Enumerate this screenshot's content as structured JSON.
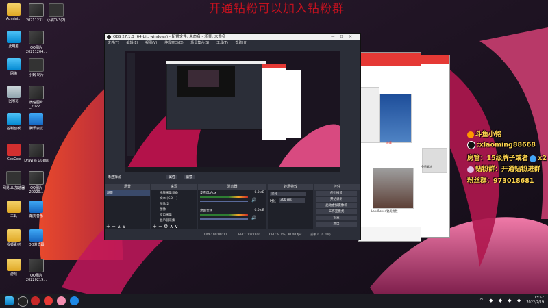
{
  "banner": "开通钻粉可以加入钻粉群",
  "desktop_icons": [
    {
      "label": "Admini...",
      "kind": "folder"
    },
    {
      "label": "20211231...",
      "kind": "thumb"
    },
    {
      "label": "小蜗TV3(2)",
      "kind": "darkapp"
    },
    {
      "label": "此电脑",
      "kind": "pc"
    },
    {
      "label": "QQ图片 20211204...",
      "kind": "thumb"
    },
    {
      "label": "网络",
      "kind": "pc"
    },
    {
      "label": "小蜗-制片",
      "kind": "darkapp"
    },
    {
      "label": "回收站",
      "kind": "bin"
    },
    {
      "label": "微信图片 _2022...",
      "kind": "thumb"
    },
    {
      "label": "控制面板",
      "kind": "pc"
    },
    {
      "label": "腾讯会议",
      "kind": "blueapp"
    },
    {
      "label": "GeeGee",
      "kind": "redapp"
    },
    {
      "label": "Draw & Guess",
      "kind": "thumb"
    },
    {
      "label": "网易UU加速器",
      "kind": "darkapp"
    },
    {
      "label": "QQ图片 20220...",
      "kind": "thumb"
    },
    {
      "label": "工具",
      "kind": "folder"
    },
    {
      "label": "酷狗音乐",
      "kind": "blueapp"
    },
    {
      "label": "视频素材",
      "kind": "folder"
    },
    {
      "label": "QQ浏览器",
      "kind": "blueapp"
    },
    {
      "label": "游戏",
      "kind": "folder"
    },
    {
      "label": "QQ图片 20220219...",
      "kind": "thumb"
    }
  ],
  "obs": {
    "title": "OBS 27.1.3 (64-bit, windows) - 配置文件: 未命名 - 场景: 未命名",
    "menu": [
      "文件(F)",
      "编辑(E)",
      "视图(V)",
      "停靠窗口(D)",
      "场景集合(S)",
      "工具(T)",
      "帮助(H)"
    ],
    "no_source": "未选择源",
    "props": "属性",
    "filters": "滤镜",
    "docks": {
      "scenes": "场景",
      "sources": "来源",
      "mixer": "混音器",
      "transitions": "转场特效",
      "controls": "控件"
    },
    "scene_item": "场景",
    "sources": [
      "视频采集设备",
      "文本 (GDI+)",
      "图像 2",
      "图像",
      "窗口采集",
      "显示器采集"
    ],
    "mixer": {
      "ch1": "麦克风/Aux",
      "ch2": "桌面音频",
      "ch1_db": "0.0 dB",
      "ch2_db": "0.0 dB"
    },
    "transition": {
      "type": "淡化",
      "duration_label": "时长",
      "duration": "300 ms"
    },
    "controls": [
      "停止推流",
      "开始录制",
      "启动虚拟摄像机",
      "工作室模式",
      "设置",
      "退出"
    ],
    "status": {
      "live": "LIVE: 00:00:00",
      "rec": "REC: 00:00:00",
      "cpu": "CPU: 9.1%, 30.00 fps",
      "dropped": "丢帧 0 (0.0%)"
    }
  },
  "browser": {
    "thumb_label1": "LandRover/路虎揽胜",
    "card_label": "收藏",
    "side_text1": "免费解冻",
    "side_text2": "ONSHY"
  },
  "overlay": {
    "douyu": "斗鱼小铭",
    "tiktok": ":xlaoming88668",
    "room": "房管：15级牌子或者",
    "x2": "x2",
    "fans": "钻粉群：开通钻粉进群",
    "fans_group": "粉丝群：973018681"
  },
  "taskbar": {
    "time": "13:52",
    "date": "2022/2/19"
  },
  "colors": {
    "banner": "#c1121f",
    "overlay": "#ffd54f",
    "browser_accent": "#e53935"
  }
}
